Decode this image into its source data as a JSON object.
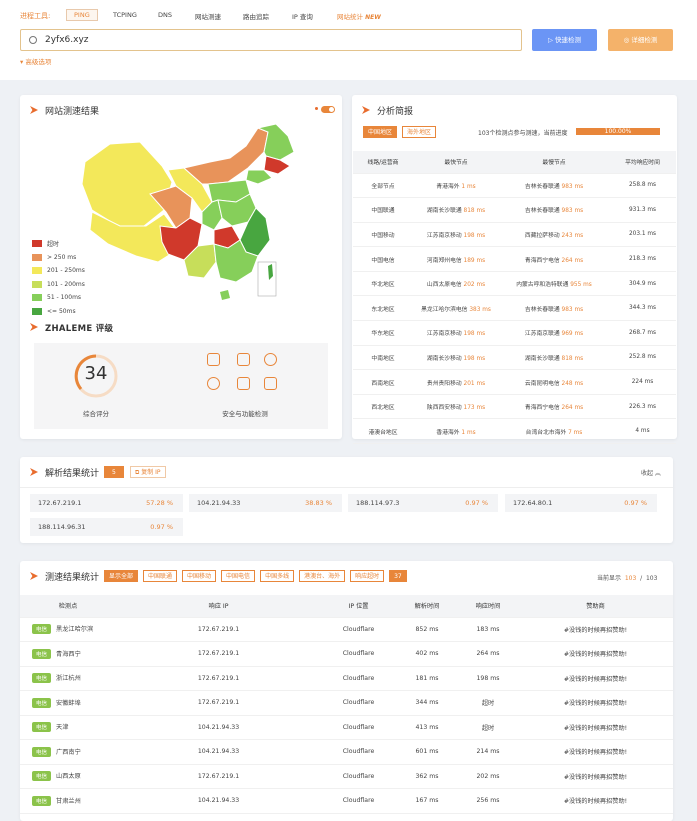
{
  "toolbar": {
    "label": "进程工具:",
    "tools": [
      "PING",
      "TCPING",
      "DNS",
      "网站测速",
      "路由追踪",
      "IP 查询",
      "网站统计"
    ],
    "new_badge": "NEW"
  },
  "search": {
    "value": "2yfx6.xyz",
    "fast_btn": "快速检测",
    "detail_btn": "详细检测",
    "advanced": "高级选项"
  },
  "speed_panel": {
    "title": "网站测速结果"
  },
  "legend": [
    {
      "label": "超时",
      "color": "#d0392b"
    },
    {
      "label": "> 250 ms",
      "color": "#e8935a"
    },
    {
      "label": "201 - 250ms",
      "color": "#f3e85a"
    },
    {
      "label": "101 - 200ms",
      "color": "#c7de5a"
    },
    {
      "label": "51 - 100ms",
      "color": "#86cf5a"
    },
    {
      "label": "<= 50ms",
      "color": "#48a640"
    }
  ],
  "rating": {
    "title": "ZHALEME 评级",
    "score": "34",
    "score_label": "综合评分",
    "security_label": "安全与功能检测"
  },
  "analysis": {
    "title": "分析简报",
    "tabs": [
      "中国地区",
      "海外地区"
    ],
    "summary": "103个检测点参与测速，当前进度",
    "progress_label": "100.00%",
    "progress": 1.0,
    "headers": [
      "线路/运营商",
      "最快节点",
      "最慢节点",
      "平均响应时间"
    ],
    "rows": [
      [
        "全部节点",
        "青港海外",
        "1 ms",
        "吉林长春联通",
        "983 ms",
        "258.8 ms"
      ],
      [
        "中国联通",
        "湖南长沙联通",
        "818 ms",
        "吉林长春联通",
        "983 ms",
        "931.3 ms"
      ],
      [
        "中国移动",
        "江苏南京移动",
        "198 ms",
        "西藏拉萨移动",
        "243 ms",
        "203.1 ms"
      ],
      [
        "中国电信",
        "河南郑州电信",
        "189 ms",
        "青海西宁电信",
        "264 ms",
        "218.3 ms"
      ],
      [
        "华北地区",
        "山西太原电信",
        "202 ms",
        "内蒙古呼和浩特联通",
        "955 ms",
        "304.9 ms"
      ],
      [
        "东北地区",
        "黑龙江哈尔滨电信",
        "383 ms",
        "吉林长春联通",
        "983 ms",
        "344.3 ms"
      ],
      [
        "华东地区",
        "江苏南京移动",
        "198 ms",
        "江苏南京联通",
        "969 ms",
        "268.7 ms"
      ],
      [
        "中南地区",
        "湖南长沙移动",
        "198 ms",
        "湖南长沙联通",
        "818 ms",
        "252.8 ms"
      ],
      [
        "西南地区",
        "贵州贵阳移动",
        "201 ms",
        "云南昆明电信",
        "248 ms",
        "224 ms"
      ],
      [
        "西北地区",
        "陕西西安移动",
        "173 ms",
        "青海西宁电信",
        "264 ms",
        "226.3 ms"
      ],
      [
        "港澳台地区",
        "香港海外",
        "1 ms",
        "台湾台北市海外",
        "7 ms",
        "4 ms"
      ]
    ]
  },
  "resolve": {
    "title": "解析结果统计",
    "count": "5",
    "filter": "复制 IP",
    "collapse": "收起",
    "ips": [
      {
        "ip": "172.67.219.1",
        "pct": "57.28 %"
      },
      {
        "ip": "104.21.94.33",
        "pct": "38.83 %"
      },
      {
        "ip": "188.114.97.3",
        "pct": "0.97 %"
      },
      {
        "ip": "172.64.80.1",
        "pct": "0.97 %"
      },
      {
        "ip": "188.114.96.31",
        "pct": "0.97 %"
      }
    ]
  },
  "results": {
    "title": "测速结果统计",
    "filters": [
      "显示全部",
      "中国联通",
      "中国移动",
      "中国电信",
      "中国多线",
      "港澳台、海外",
      "响应超时"
    ],
    "timeout_count": "37",
    "shown_label": "当前显示",
    "shown": "103",
    "total": "103",
    "headers": [
      "检测点",
      "响应 IP",
      "IP 位置",
      "解析时间",
      "响应时间",
      "赞助商"
    ],
    "rows": [
      {
        "isp": "电信",
        "loc": "黑龙江哈尔滨",
        "ip": "172.67.219.1",
        "pos": "Cloudflare",
        "dns": "852 ms",
        "resp": "183 ms",
        "sponsor": "#没钱的时候再招赞助!"
      },
      {
        "isp": "电信",
        "loc": "青海西宁",
        "ip": "172.67.219.1",
        "pos": "Cloudflare",
        "dns": "402 ms",
        "resp": "264 ms",
        "sponsor": "#没钱的时候再招赞助!"
      },
      {
        "isp": "电信",
        "loc": "浙江杭州",
        "ip": "172.67.219.1",
        "pos": "Cloudflare",
        "dns": "181 ms",
        "resp": "198 ms",
        "sponsor": "#没钱的时候再招赞助!"
      },
      {
        "isp": "电信",
        "loc": "安徽蚌埠",
        "ip": "172.67.219.1",
        "pos": "Cloudflare",
        "dns": "344 ms",
        "resp": "超时",
        "sponsor": "#没钱的时候再招赞助!"
      },
      {
        "isp": "电信",
        "loc": "天津",
        "ip": "104.21.94.33",
        "pos": "Cloudflare",
        "dns": "413 ms",
        "resp": "超时",
        "sponsor": "#没钱的时候再招赞助!"
      },
      {
        "isp": "电信",
        "loc": "广西南宁",
        "ip": "104.21.94.33",
        "pos": "Cloudflare",
        "dns": "601 ms",
        "resp": "214 ms",
        "sponsor": "#没钱的时候再招赞助!"
      },
      {
        "isp": "电信",
        "loc": "山西太原",
        "ip": "172.67.219.1",
        "pos": "Cloudflare",
        "dns": "362 ms",
        "resp": "202 ms",
        "sponsor": "#没钱的时候再招赞助!"
      },
      {
        "isp": "电信",
        "loc": "甘肃兰州",
        "ip": "104.21.94.33",
        "pos": "Cloudflare",
        "dns": "167 ms",
        "resp": "256 ms",
        "sponsor": "#没钱的时候再招赞助!"
      }
    ]
  },
  "colors": {
    "accent": "#e8863a",
    "blue": "#6b95f5"
  }
}
